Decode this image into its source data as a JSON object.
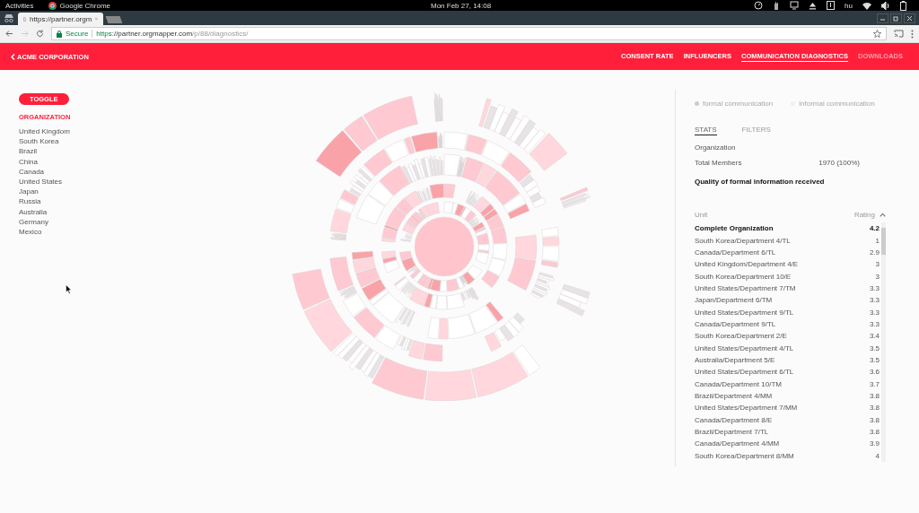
{
  "system_bar": {
    "activities": "Activities",
    "app": "Google Chrome",
    "clock": "Mon Feb 27, 14:08",
    "language": "hu"
  },
  "browser": {
    "tab_title": "https://partner.orgm",
    "secure_label": "Secure",
    "url_scheme": "https",
    "url_host": "://partner.orgmapper.com",
    "url_path": "/p/88/diagnostics/"
  },
  "nav": {
    "back_label": "ACME CORPORATION",
    "items": [
      {
        "label": "CONSENT RATE",
        "selected": false,
        "disabled": false
      },
      {
        "label": "INFLUENCERS",
        "selected": false,
        "disabled": false
      },
      {
        "label": "COMMUNICATION DIAGNOSTICS",
        "selected": true,
        "disabled": false
      },
      {
        "label": "DOWNLOADS",
        "selected": false,
        "disabled": true
      }
    ]
  },
  "sidebar": {
    "toggle": "TOGGLE",
    "heading": "ORGANIZATION",
    "items": [
      "United Kingdom",
      "South Korea",
      "Brazil",
      "China",
      "Canada",
      "United States",
      "Japan",
      "Russia",
      "Australia",
      "Germany",
      "Mexico"
    ]
  },
  "panel": {
    "modes": [
      {
        "label": "formal communication",
        "selected": true
      },
      {
        "label": "informal communication",
        "selected": false
      }
    ],
    "tabs": [
      {
        "label": "STATS",
        "selected": true
      },
      {
        "label": "FILTERS",
        "selected": false
      }
    ],
    "organization_label": "Organization",
    "members_label": "Total Members",
    "members_value": "1970 (100%)",
    "question": "Quality of formal information received",
    "table": {
      "columns": [
        "Unit",
        "Rating"
      ],
      "total": {
        "unit": "Complete Organization",
        "rating": "4.2"
      },
      "rows": [
        {
          "unit": "South Korea/Department 4/TL",
          "rating": "1"
        },
        {
          "unit": "Canada/Department 6/TL",
          "rating": "2.9"
        },
        {
          "unit": "United Kingdom/Department 4/E",
          "rating": "3"
        },
        {
          "unit": "South Korea/Department 10/E",
          "rating": "3"
        },
        {
          "unit": "United States/Department 7/TM",
          "rating": "3.3"
        },
        {
          "unit": "Japan/Department 6/TM",
          "rating": "3.3"
        },
        {
          "unit": "United States/Department 9/TL",
          "rating": "3.3"
        },
        {
          "unit": "Canada/Department 9/TL",
          "rating": "3.3"
        },
        {
          "unit": "South Korea/Department 2/E",
          "rating": "3.4"
        },
        {
          "unit": "United States/Department 4/TL",
          "rating": "3.5"
        },
        {
          "unit": "Australia/Department 5/E",
          "rating": "3.5"
        },
        {
          "unit": "United States/Department 6/TL",
          "rating": "3.6"
        },
        {
          "unit": "Canada/Department 10/TM",
          "rating": "3.7"
        },
        {
          "unit": "Brazil/Department 4/MM",
          "rating": "3.8"
        },
        {
          "unit": "United States/Department 7/MM",
          "rating": "3.8"
        },
        {
          "unit": "Canada/Department 8/E",
          "rating": "3.8"
        },
        {
          "unit": "Brazil/Department 7/TL",
          "rating": "3.8"
        },
        {
          "unit": "Canada/Department 4/MM",
          "rating": "3.9"
        },
        {
          "unit": "South Korea/Department 8/MM",
          "rating": "4"
        }
      ]
    }
  }
}
